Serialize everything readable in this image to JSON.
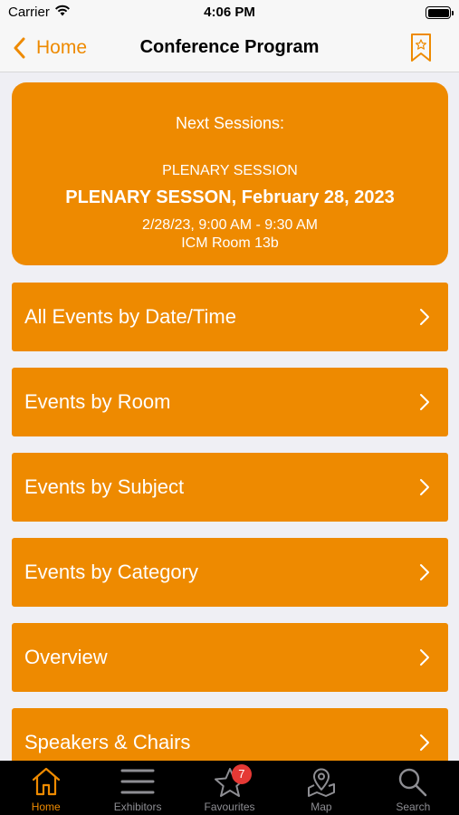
{
  "status": {
    "carrier": "Carrier",
    "time": "4:06 PM",
    "battery_level": 1.0
  },
  "nav": {
    "back_label": "Home",
    "title": "Conference Program",
    "bookmark_icon": "bookmark-star-icon"
  },
  "next_sessions": {
    "heading": "Next Sessions:",
    "type": "PLENARY SESSION",
    "title": "PLENARY SESSON, February 28, 2023",
    "time": "2/28/23, 9:00 AM - 9:30 AM",
    "room": "ICM Room 13b"
  },
  "menu": [
    {
      "label": "All Events by Date/Time"
    },
    {
      "label": "Events by Room"
    },
    {
      "label": "Events by Subject"
    },
    {
      "label": "Events by Category"
    },
    {
      "label": "Overview"
    },
    {
      "label": "Speakers & Chairs"
    }
  ],
  "tabs": [
    {
      "label": "Home",
      "icon": "home-icon",
      "active": true
    },
    {
      "label": "Exhibitors",
      "icon": "list-icon"
    },
    {
      "label": "Favourites",
      "icon": "star-icon",
      "badge": "7"
    },
    {
      "label": "Map",
      "icon": "map-pin-icon"
    },
    {
      "label": "Search",
      "icon": "search-icon"
    }
  ],
  "colors": {
    "accent": "#ee8a00",
    "tab_bar": "#000000",
    "badge": "#e53935"
  }
}
